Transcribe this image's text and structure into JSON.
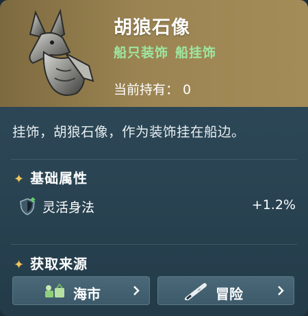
{
  "item": {
    "name": "胡狼石像",
    "tags": [
      "船只装饰",
      "船挂饰"
    ],
    "owned_label": "当前持有：",
    "owned_count": "0",
    "description": "挂饰，胡狼石像，作为装饰挂在船边。"
  },
  "sections": {
    "attributes_title": "基础属性",
    "attributes": [
      {
        "name": "灵活身法",
        "value": "+1.2%",
        "icon": "shield-icon"
      }
    ],
    "sources_title": "获取来源",
    "sources": [
      {
        "label": "海市",
        "icon": "market-icon"
      },
      {
        "label": "冒险",
        "icon": "spyglass-icon"
      }
    ]
  },
  "colors": {
    "header_gold": "#9b8452",
    "tag_green": "#9ee6a0",
    "star_gold": "#f1c55c",
    "panel_blue": "#2f4a59"
  }
}
